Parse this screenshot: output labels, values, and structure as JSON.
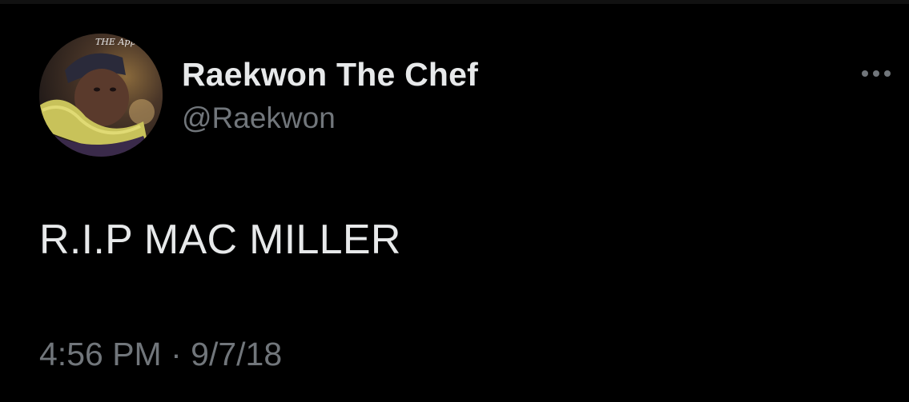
{
  "tweet": {
    "display_name": "Raekwon The Chef",
    "handle": "@Raekwon",
    "text": "R.I.P MAC MILLER",
    "time": "4:56 PM",
    "separator": "·",
    "date": "9/7/18",
    "more_icon": "more-horizontal-icon",
    "avatar_logo_text": "THE Appe"
  },
  "colors": {
    "background": "#000000",
    "primary_text": "#e7e9ea",
    "secondary_text": "#71767b"
  }
}
